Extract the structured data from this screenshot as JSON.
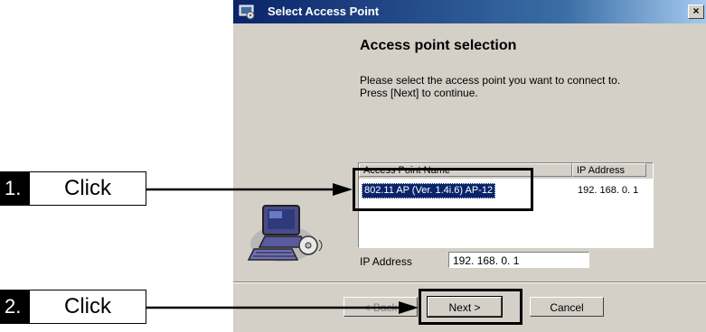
{
  "window": {
    "title": "Select Access Point",
    "close_glyph": "×"
  },
  "page": {
    "heading": "Access point selection",
    "description_line1": "Please select the access point you want to connect to.",
    "description_line2": "Press [Next] to continue."
  },
  "list": {
    "columns": [
      "Access Point Name",
      "IP Address"
    ],
    "rows": [
      {
        "name": "802.11 AP (Ver. 1.4i.6) AP-12",
        "ip": "192. 168. 0. 1",
        "selected": true
      }
    ]
  },
  "ip_field": {
    "label": "IP Address",
    "value": "192. 168.  0.  1"
  },
  "buttons": {
    "back": "< Back",
    "next": "Next >",
    "cancel": "Cancel"
  },
  "callouts": [
    {
      "number": "1.",
      "text": "Click"
    },
    {
      "number": "2.",
      "text": "Click"
    }
  ],
  "icons": {
    "app": "settings-app-icon",
    "computer": "computer-cd-icon"
  }
}
